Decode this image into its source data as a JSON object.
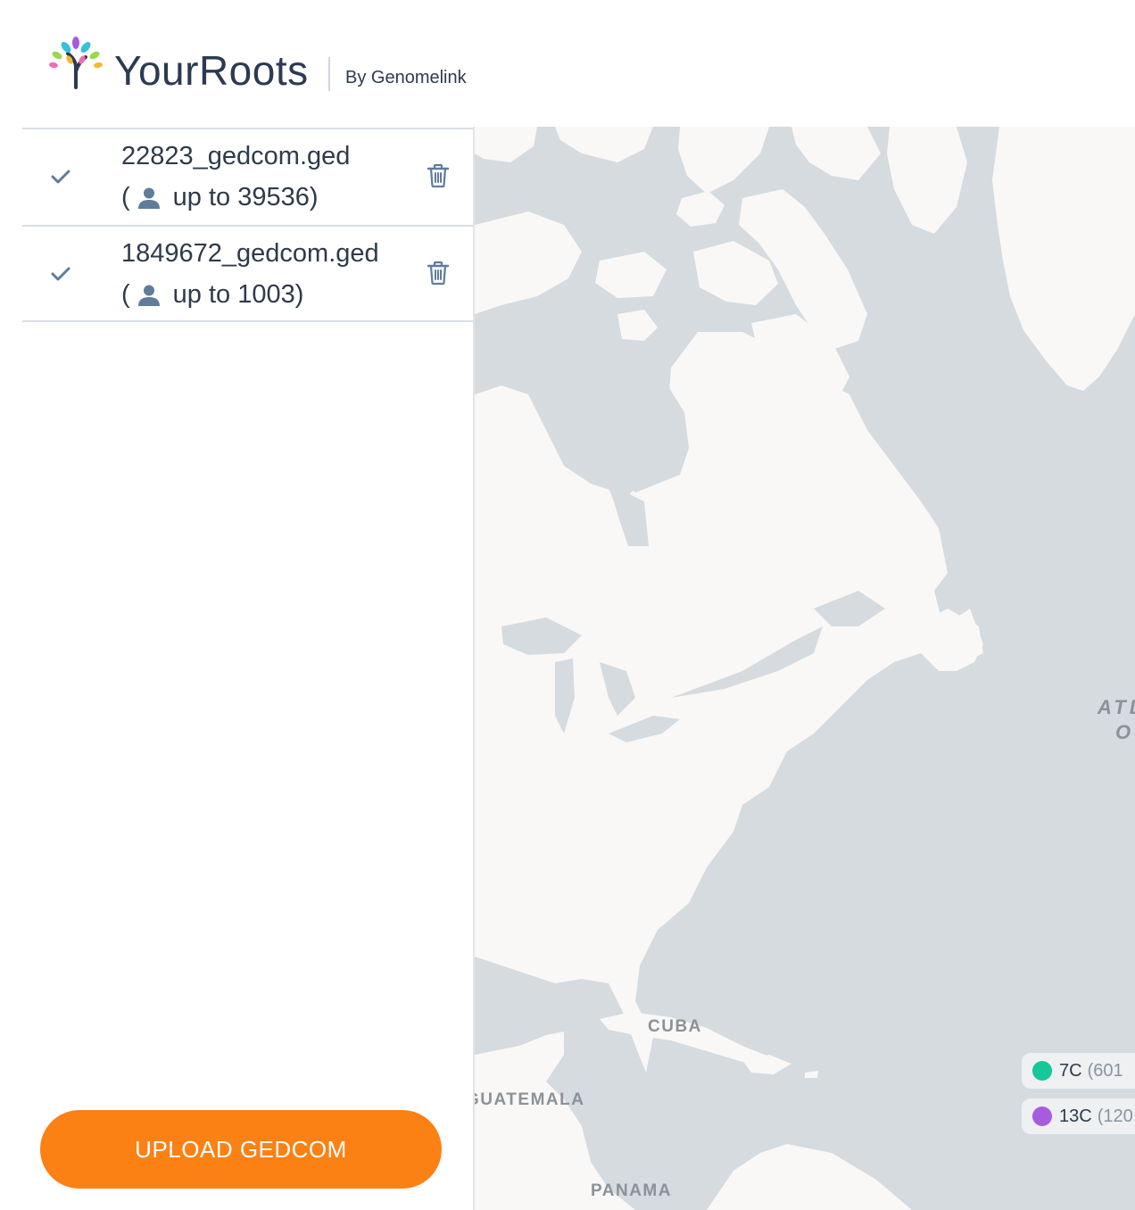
{
  "header": {
    "brand": "YourRoots",
    "byline": "By Genomelink"
  },
  "files": [
    {
      "name": "22823_gedcom.ged",
      "open": "(",
      "count_text": "up to 39536)"
    },
    {
      "name": "1849672_gedcom.ged",
      "open": "(",
      "count_text": "up to 1003)"
    }
  ],
  "upload_label": "UPLOAD GEDCOM",
  "map": {
    "labels": {
      "cuba": "CUBA",
      "guatemala": "GUATEMALA",
      "panama": "PANAMA",
      "ocean_line1": "ATLANTIC",
      "ocean_line2": "OCEAN"
    },
    "legend": [
      {
        "code": "7C",
        "count": "(601",
        "color": "#16c79a"
      },
      {
        "code": "13C",
        "count": "(120",
        "color": "#a75cdf"
      }
    ]
  },
  "colors": {
    "accent": "#fb8114",
    "land": "#f9f8f7",
    "water": "#d5dbdf",
    "icon": "#5f7c9c"
  },
  "icons": [
    "tree-logo-icon",
    "check-icon",
    "person-icon",
    "trash-icon"
  ]
}
